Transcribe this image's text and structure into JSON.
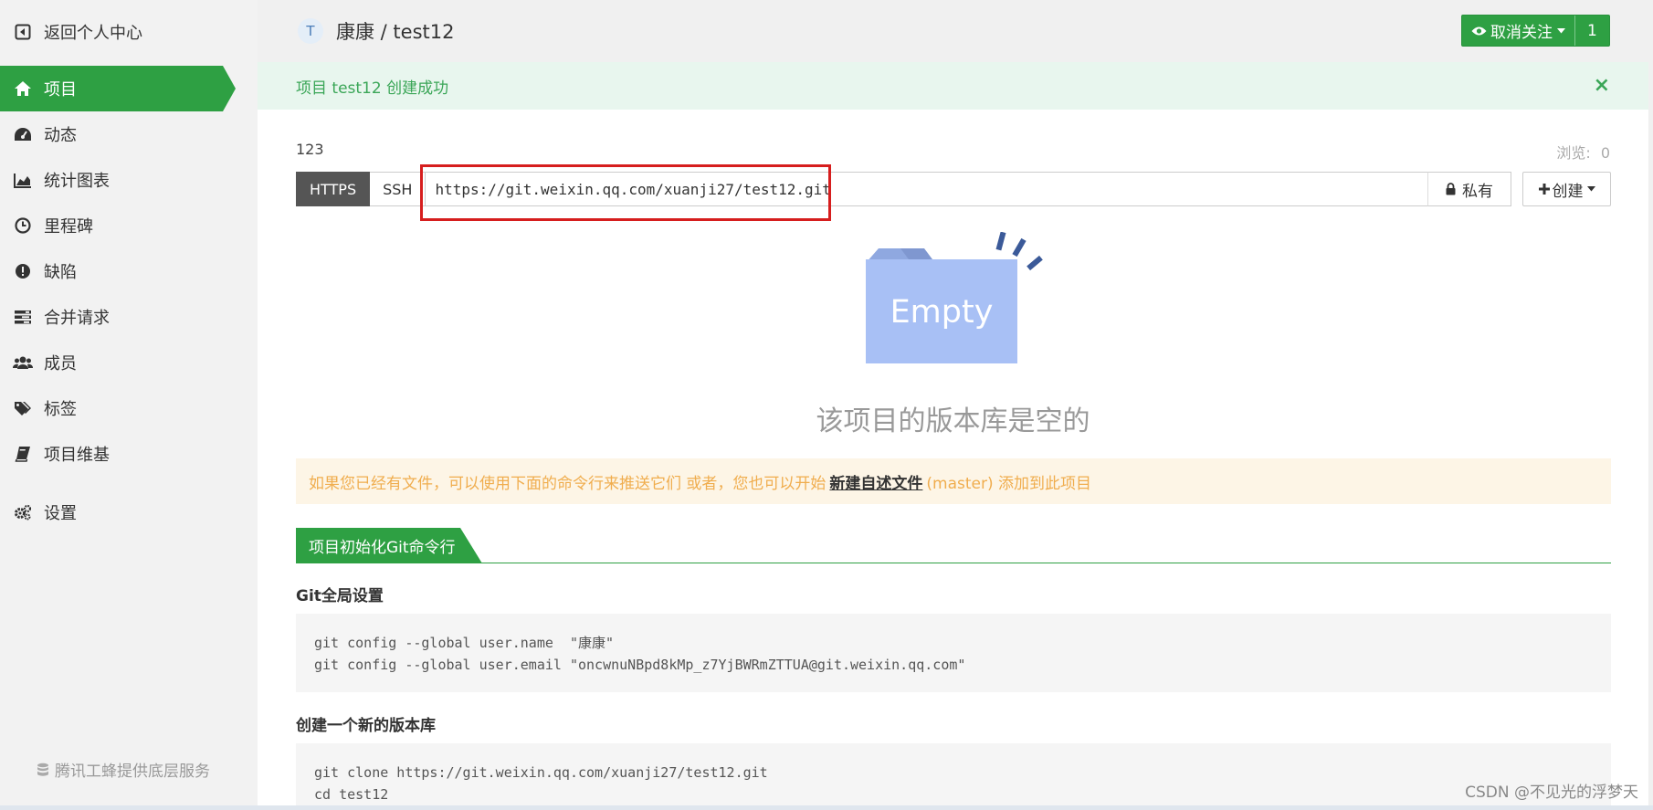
{
  "sidebar": {
    "back_label": "返回个人中心",
    "items": [
      {
        "label": "项目",
        "icon": "home-icon",
        "active": true
      },
      {
        "label": "动态",
        "icon": "dashboard-icon"
      },
      {
        "label": "统计图表",
        "icon": "area-chart-icon"
      },
      {
        "label": "里程碑",
        "icon": "clock-icon"
      },
      {
        "label": "缺陷",
        "icon": "exclamation-circle-icon"
      },
      {
        "label": "合并请求",
        "icon": "tasks-icon"
      },
      {
        "label": "成员",
        "icon": "users-icon"
      },
      {
        "label": "标签",
        "icon": "tags-icon"
      },
      {
        "label": "项目维基",
        "icon": "book-icon"
      },
      {
        "label": "设置",
        "icon": "cogs-icon"
      }
    ],
    "footer": "腾讯工蜂提供底层服务"
  },
  "header": {
    "avatar_letter": "T",
    "breadcrumb": "康康 / test12",
    "watch_label": "取消关注",
    "watch_count": "1"
  },
  "main": {
    "success_alert": "项目 test12 创建成功",
    "close_symbol": "×",
    "description": "123",
    "views_label": "浏览:",
    "views_count": "0",
    "protocols": [
      "HTTPS",
      "SSH"
    ],
    "clone_url": "https://git.weixin.qq.com/xuanji27/test12.git",
    "visibility": "私有",
    "create_label": "创建",
    "empty_label": "Empty",
    "empty_title": "该项目的版本库是空的",
    "warning": {
      "before": "如果您已经有文件，可以使用下面的命令行来推送它们 或者，您也可以开始",
      "link": "新建自述文件",
      "after": "(master) 添加到此项目"
    },
    "section_tab": "项目初始化Git命令行",
    "global_title": "Git全局设置",
    "global_lines": [
      "git config --global user.name  \"康康\"",
      "git config --global user.email \"oncwnuNBpd8kMp_z7YjBWRmZTTUA@git.weixin.qq.com\""
    ],
    "newrepo_title": "创建一个新的版本库",
    "newrepo_lines": [
      "git clone https://git.weixin.qq.com/xuanji27/test12.git",
      "cd test12"
    ]
  },
  "watermark": "CSDN @不见光的浮梦天",
  "colors": {
    "accent": "#2ea043",
    "success_bg": "#e8f6ee",
    "warning_bg": "#fdf5e6",
    "warning_text": "#f0ad4e",
    "highlight": "#d61e1e",
    "empty_folder": "#a8c0f5"
  }
}
